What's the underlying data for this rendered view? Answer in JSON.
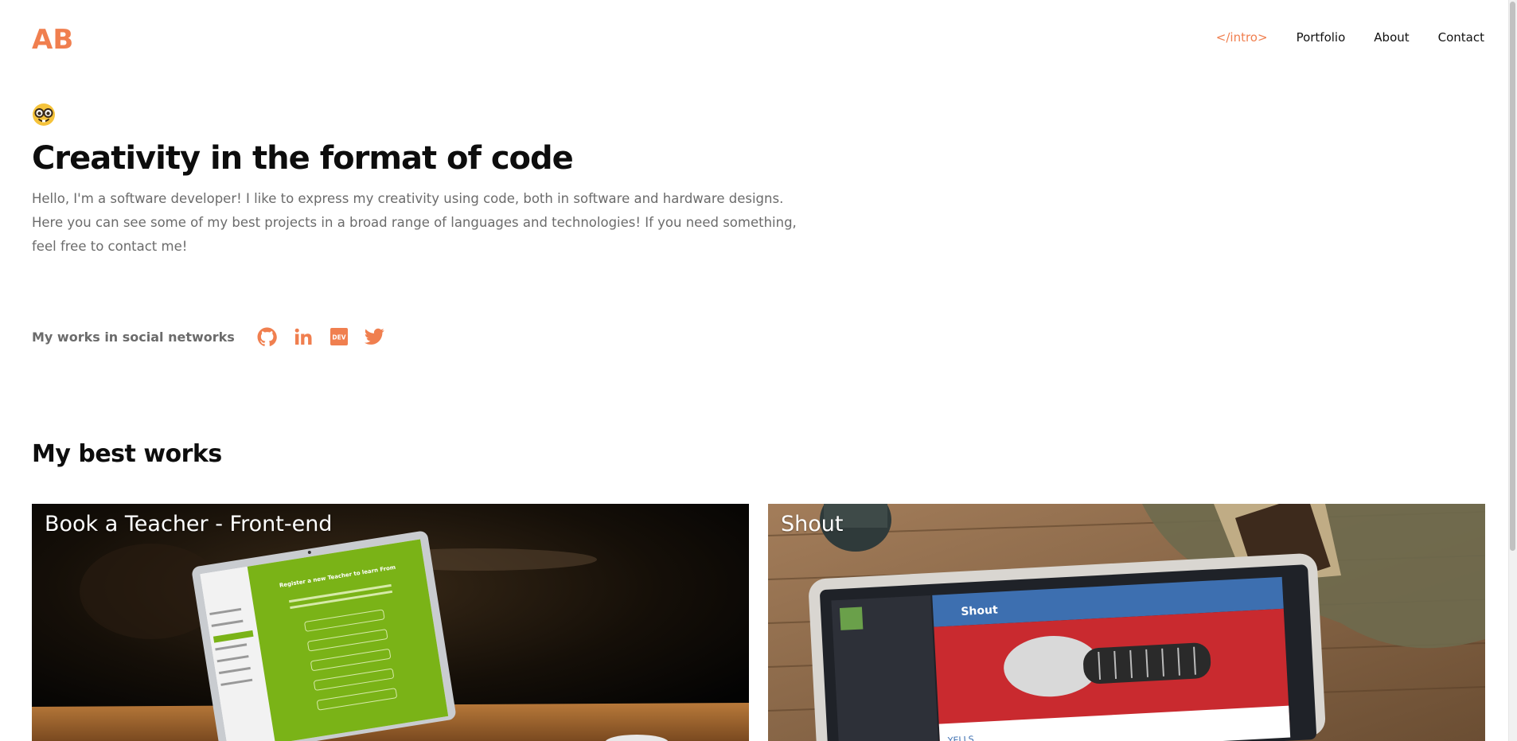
{
  "colors": {
    "accent": "#f07f4f",
    "text_dark": "#0d0d0d",
    "text_muted": "#6b6b6b"
  },
  "header": {
    "logo": "AB",
    "nav": [
      {
        "label": "</intro>",
        "active": true
      },
      {
        "label": "Portfolio",
        "active": false
      },
      {
        "label": "About",
        "active": false
      },
      {
        "label": "Contact",
        "active": false
      }
    ]
  },
  "hero": {
    "emoji_icon": "nerd-face-icon",
    "title": "Creativity in the format of code",
    "intro": "Hello, I'm a software developer! I like to express my creativity using code, both in software and hardware designs. Here you can see some of my best projects in a broad range of languages and technologies! If you need something, feel free to contact me!"
  },
  "social": {
    "label": "My works in social networks",
    "icons": [
      "github-icon",
      "linkedin-icon",
      "dev-icon",
      "twitter-icon"
    ],
    "dev_badge_text": "DEV"
  },
  "works": {
    "heading": "My best works",
    "cards": [
      {
        "title": "Book a Teacher - Front-end"
      },
      {
        "title": "Shout"
      }
    ],
    "screens": {
      "teacher_form_heading": "Register a new Teacher to learn From",
      "shout_header": "Shout",
      "shout_label": "YELLS"
    }
  }
}
